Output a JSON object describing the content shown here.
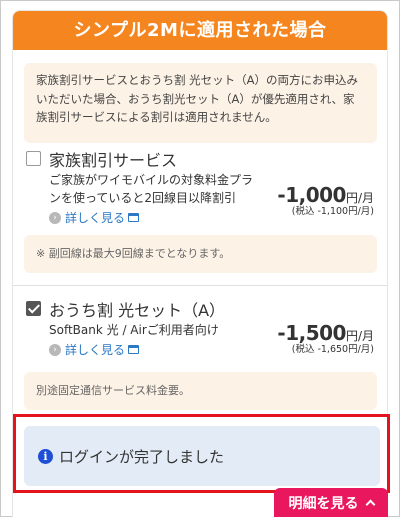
{
  "header": {
    "title": "シンプル2Mに適用された場合"
  },
  "notice": {
    "text": "家族割引サービスとおうち割 光セット（A）の両方にお申込みいただいた場合、おうち割光セット（A）が優先適用され、家族割引サービスによる割引は適用されません。"
  },
  "options": [
    {
      "title": "家族割引サービス",
      "checked": false,
      "description": "ご家族がワイモバイルの対象料金プランを使っていると2回線目以降割引",
      "link_label": "詳しく見る",
      "price": "-1,000",
      "price_unit": "円/月",
      "price_sub": "(税込 -1,100円/月)",
      "note": "※ 副回線は最大9回線までとなります。"
    },
    {
      "title": "おうち割 光セット（A）",
      "checked": true,
      "description": "SoftBank 光 / Airご利用者向け",
      "link_label": "詳しく見る",
      "price": "-1,500",
      "price_unit": "円/月",
      "price_sub": "(税込 -1,650円/月)",
      "note": "別途固定通信サービス料金要。"
    }
  ],
  "login_banner": {
    "text": "ログインが完了しました"
  },
  "details_button": {
    "label": "明細を見る"
  },
  "colors": {
    "header_orange": "#f5861f",
    "notice_bg": "#fdf2e6",
    "link_blue": "#2b78c5",
    "banner_bg": "#e3ecf6",
    "info_blue": "#1f4fd6",
    "highlight_red": "#e5141c",
    "button_pink": "#e8175e"
  },
  "icons": {
    "info": "info-icon",
    "arrow": "arrow-circle-icon",
    "external": "new-window-icon",
    "chevron": "chevron-up-icon"
  }
}
